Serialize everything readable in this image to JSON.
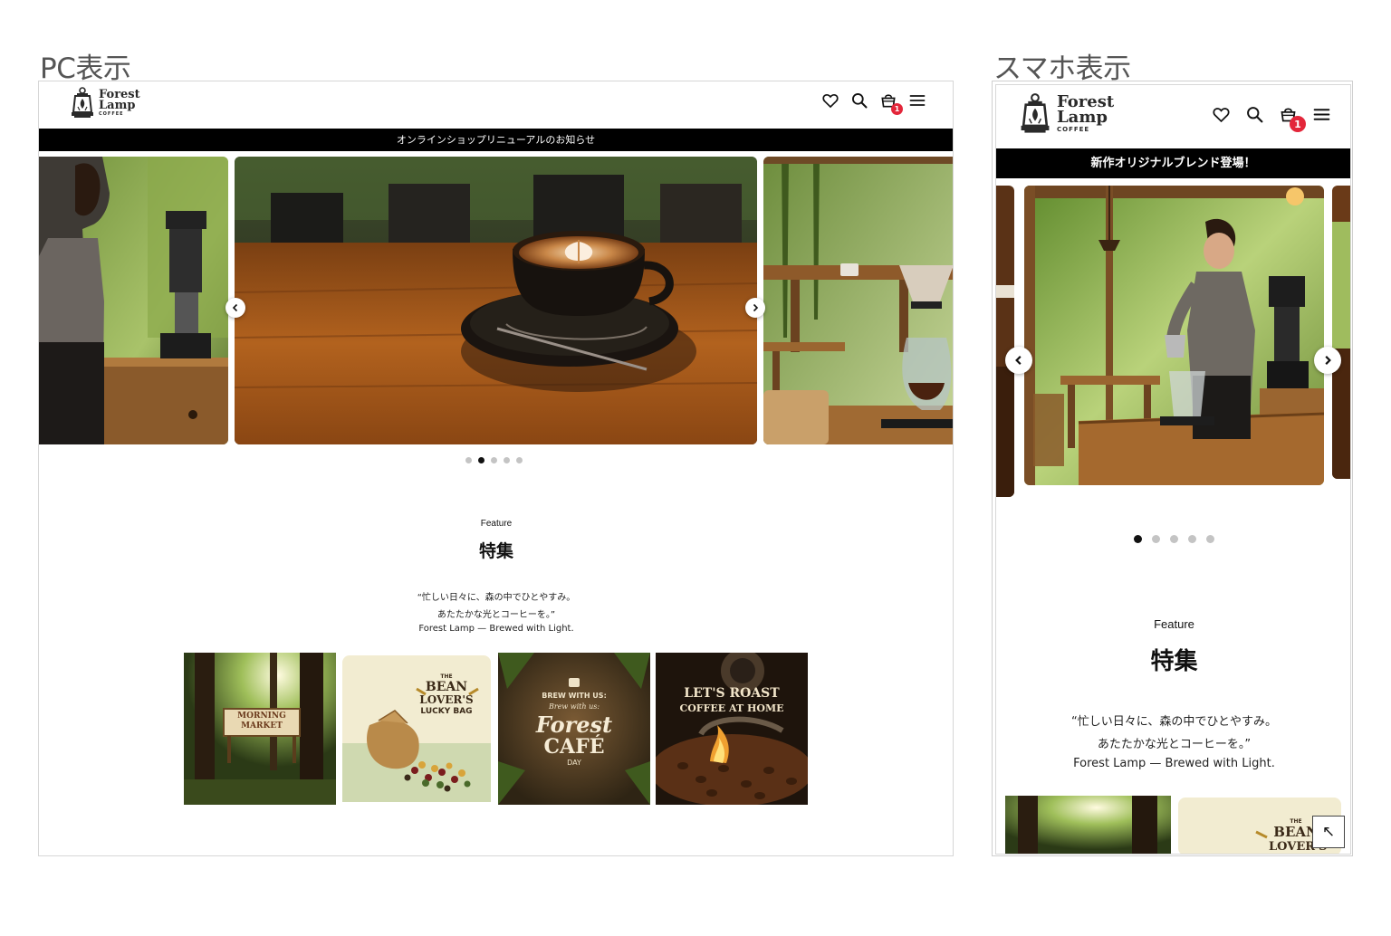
{
  "labels": {
    "pc": "PC表示",
    "sp": "スマホ表示"
  },
  "brand": {
    "name_line1": "Forest",
    "name_line2": "Lamp",
    "sub": "COFFEE"
  },
  "header": {
    "icons": [
      "heart-icon",
      "search-icon",
      "cart-icon",
      "menu-icon"
    ],
    "cart_count": "1",
    "badge_color": "#e3263a"
  },
  "pc": {
    "notice": "オンラインショップリニューアルのお知らせ",
    "carousel": {
      "slides": 5,
      "active": 2
    },
    "feature": {
      "eyebrow": "Feature",
      "title": "特集",
      "quote": [
        "“忙しい日々に、森の中でひとやすみ。",
        "あたたかな光とコーヒーを。”",
        "Forest Lamp — Brewed with Light."
      ]
    },
    "tiles": [
      {
        "name": "morning-market",
        "text": [
          "MORNING",
          "MARKET"
        ]
      },
      {
        "name": "bean-lovers-lucky-bag",
        "text": [
          "THE",
          "BEAN",
          "LOVER'S",
          "LUCKY BAG"
        ]
      },
      {
        "name": "forest-cafe-day",
        "text": [
          "BREW WITH US:",
          "Brew with us:",
          "Forest",
          "CAFÉ",
          "DAY"
        ]
      },
      {
        "name": "lets-roast-coffee",
        "text": [
          "LET'S ROAST",
          "COFFEE AT HOME"
        ]
      }
    ]
  },
  "sp": {
    "notice": "新作オリジナルブレンド登場！",
    "carousel": {
      "slides": 5,
      "active": 1
    },
    "feature": {
      "eyebrow": "Feature",
      "title": "特集",
      "quote": [
        "“忙しい日々に、森の中でひとやすみ。",
        "あたたかな光とコーヒーを。”",
        "Forest Lamp — Brewed with Light."
      ]
    },
    "tile_text": [
      "THE",
      "BEAN",
      "LOVER'S"
    ],
    "scroll_top": "↖"
  },
  "colors": {
    "accent_black": "#000000",
    "badge_red": "#e3263a",
    "dot_inactive": "#c4c4c4"
  }
}
